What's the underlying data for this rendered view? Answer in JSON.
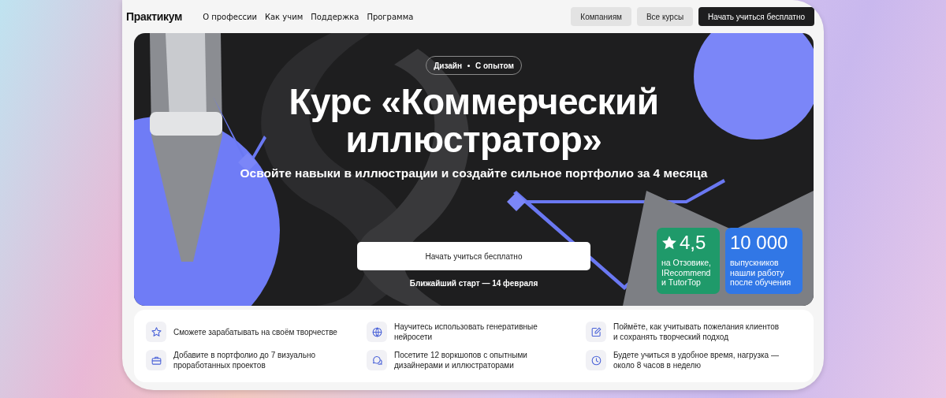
{
  "header": {
    "logo": "Практикум",
    "nav": [
      "О профессии",
      "Как учим",
      "Поддержка",
      "Программа"
    ],
    "buttons": [
      {
        "label": "Компаниям",
        "kind": "secondary"
      },
      {
        "label": "Все курсы",
        "kind": "secondary"
      },
      {
        "label": "Начать учиться бесплатно",
        "kind": "primary"
      }
    ]
  },
  "hero": {
    "kind": "picture",
    "tag": [
      "Дизайн",
      "С опытом"
    ],
    "title": "Курс «Коммерческий иллюстратор»",
    "subtitle": "Освойте навыки в иллюстрации и создайте сильное портфолио за 4 месяца",
    "cta": "Начать учиться бесплатно",
    "start": "Ближайший старт — 14 февраля",
    "stats": [
      {
        "value": "4,5",
        "text": "на Отзовике, IRecommend и TutorTop",
        "color": "#1f9a6a",
        "kind": "rating"
      },
      {
        "value": "10 000",
        "text": "выпускников нашли работу после обучения",
        "color": "#3177e6",
        "kind": "count"
      }
    ]
  },
  "features": [
    {
      "kind": "star",
      "text": "Сможете зарабатывать на своём творчестве"
    },
    {
      "kind": "globe",
      "text": "Научитесь использовать генеративные нейросети"
    },
    {
      "kind": "edit",
      "text": "Поймёте, как учитывать пожелания клиентов и сохранять творческий подход"
    },
    {
      "kind": "briefcase",
      "text": "Добавите в портфолио до 7 визуально проработанных проектов"
    },
    {
      "kind": "chat",
      "text": "Посетите 12 воркшопов с опытными дизайнерами и иллюстраторами"
    },
    {
      "kind": "clock",
      "text": "Будете учиться в удобное время, нагрузка — около 8 часов в неделю"
    }
  ]
}
